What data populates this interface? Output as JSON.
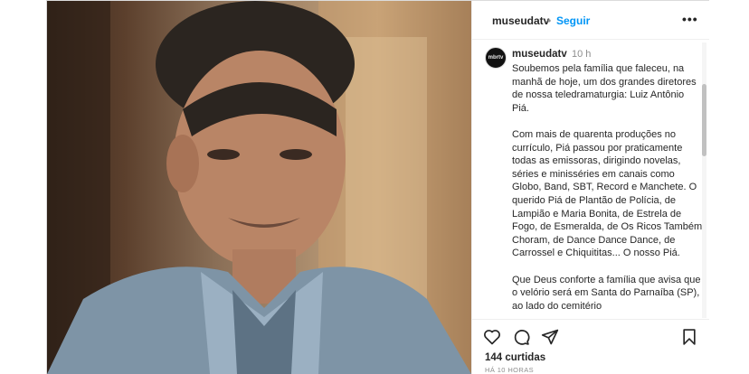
{
  "header": {
    "username": "museudatv",
    "separator": "•",
    "follow_label": "Seguir",
    "more_label": "•••"
  },
  "caption": {
    "avatar_text": "mbrtv",
    "username": "museudatv",
    "time": "10 h",
    "paragraphs": [
      "Soubemos pela família que faleceu, na manhã de hoje, um dos grandes diretores de nossa teledramaturgia: Luiz Antônio Piá.",
      "Com mais de quarenta produções no currículo, Piá passou por praticamente todas as emissoras, dirigindo novelas, séries e minisséries em canais como Globo, Band, SBT, Record e Manchete. O querido Piá de Plantão de Polícia, de Lampião e Maria Bonita, de Estrela de Fogo, de Esmeralda, de Os Ricos Também Choram, de Dance Dance Dance, de Carrossel e Chiquititas... O nosso Piá.",
      "Que Deus conforte a família que avisa que o velório será em Santa do Parnaíba (SP), ao lado do cemitério"
    ]
  },
  "footer": {
    "likes": "144 curtidas",
    "time_ago": "HÁ 10 HORAS"
  },
  "icons": [
    "heart-icon",
    "comment-icon",
    "share-icon",
    "bookmark-icon"
  ],
  "colors": {
    "accent": "#0095f6",
    "text": "#262626",
    "muted": "#8e8e8e"
  }
}
